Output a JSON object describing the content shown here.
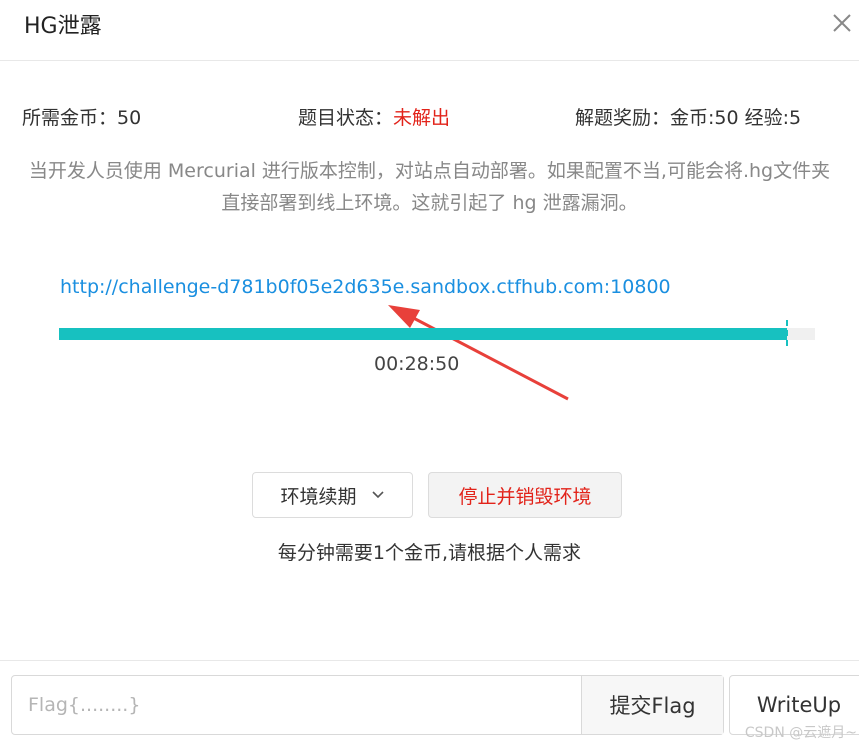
{
  "modal": {
    "title": "HG泄露",
    "close_icon": "close-icon"
  },
  "info": {
    "cost_label": "所需金币：",
    "cost_value": "50",
    "status_label": "题目状态：",
    "status_value": "未解出",
    "status_color": "#e2231a",
    "reward": "解题奖励：金币:50 经验:5"
  },
  "description": "当开发人员使用 Mercurial 进行版本控制，对站点自动部署。如果配置不当,可能会将.hg文件夹直接部署到线上环境。这就引起了 hg 泄露漏洞。",
  "challenge": {
    "url": "http://challenge-d781b0f05e2d635e.sandbox.ctfhub.com:10800",
    "progress_fraction": 0.963,
    "progress_color": "#17c1c0",
    "timer": "00:28:50"
  },
  "buttons": {
    "renew": "环境续期",
    "renew_icon": "chevron-down-icon",
    "destroy": "停止并销毁环境"
  },
  "hint": "每分钟需要1个金币,请根据个人需求",
  "flag": {
    "placeholder": "Flag{........}",
    "submit": "提交Flag",
    "writeup": "WriteUp"
  },
  "watermark": "CSDN @云遮月~"
}
